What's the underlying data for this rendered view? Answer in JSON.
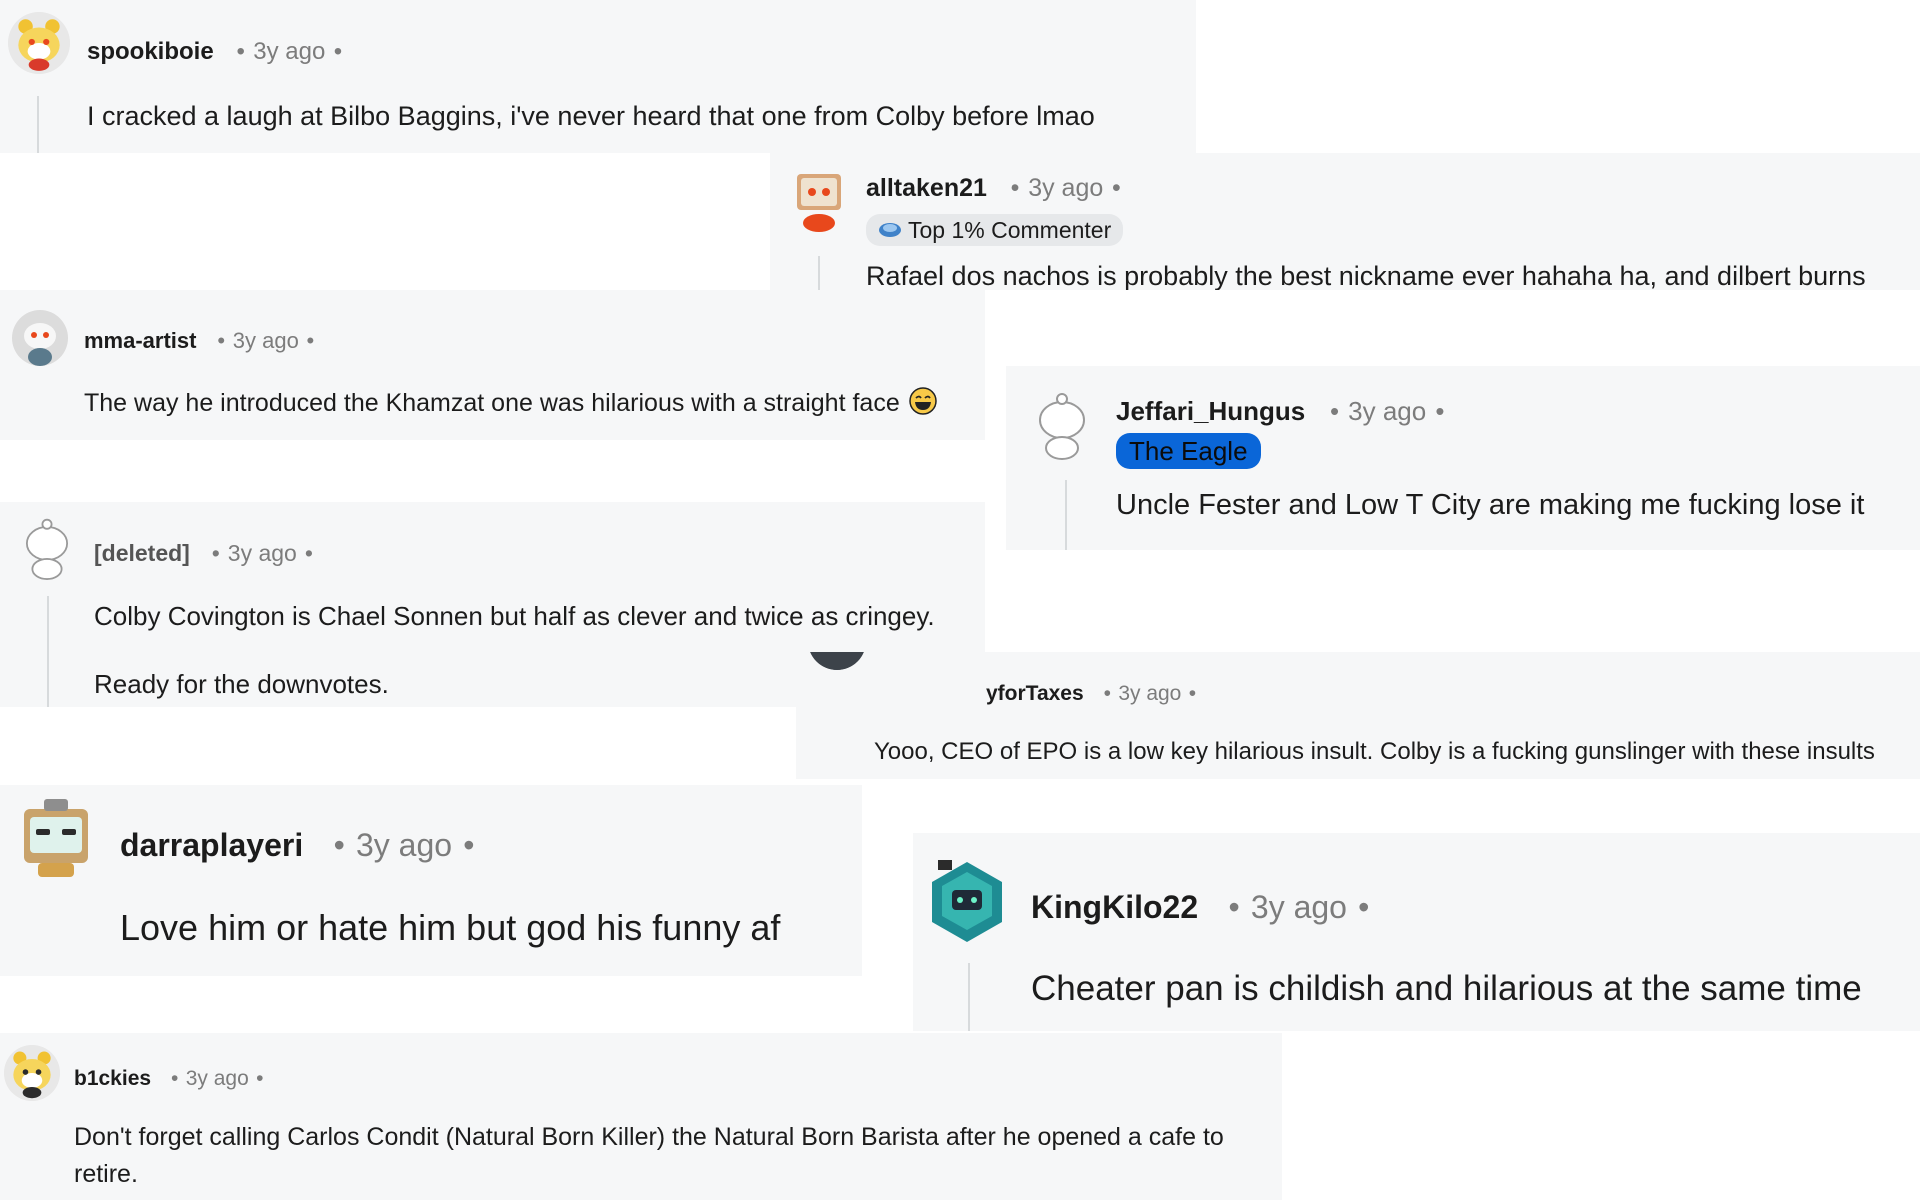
{
  "comments": [
    {
      "username": "spookiboie",
      "time": "3y ago",
      "text": "I cracked a laugh at Bilbo Baggins, i've never heard that one from Colby before lmao",
      "avatar": "bear-snoo-avatar"
    },
    {
      "username": "alltaken21",
      "time": "3y ago",
      "flair": "Top 1% Commenter",
      "flair_icon": "commenter-badge-icon",
      "text": "Rafael dos nachos is probably the best nickname ever hahaha ha, and dilbert burns",
      "avatar": "box-head-snoo-avatar"
    },
    {
      "username": "mma-artist",
      "time": "3y ago",
      "text": "The way he introduced the Khamzat one was hilarious with a straight face",
      "emoji": "laughing-emoji",
      "avatar": "grey-snoo-avatar"
    },
    {
      "username": "Jeffari_Hungus",
      "time": "3y ago",
      "flair": "The Eagle",
      "text": "Uncle Fester and Low T City are making me fucking lose it",
      "avatar": "default-snoo-avatar"
    },
    {
      "username": "[deleted]",
      "time": "3y ago",
      "text": "Colby Covington is Chael Sonnen but half as clever and twice as cringey.",
      "text2": "Ready for the downvotes.",
      "avatar": "default-snoo-avatar"
    },
    {
      "username": "yforTaxes",
      "time": "3y ago",
      "text": "Yooo, CEO of EPO is a low key hilarious insult. Colby is a fucking gunslinger with these insults",
      "avatar": "dark-avatar"
    },
    {
      "username": "darraplayeri",
      "time": "3y ago",
      "text": "Love him or hate him but god his funny af",
      "avatar": "tv-head-snoo-avatar"
    },
    {
      "username": "KingKilo22",
      "time": "3y ago",
      "text": "Cheater pan is childish and hilarious at the same time",
      "avatar": "hex-teal-avatar"
    },
    {
      "username": "b1ckies",
      "time": "3y ago",
      "text": "Don't forget calling Carlos Condit (Natural Born Killer) the Natural Born Barista after he opened a cafe to retire.",
      "avatar": "bear-snoo-avatar"
    }
  ],
  "separator": "•",
  "colors": {
    "card_bg": "#f6f7f8",
    "flair_blue": "#0a66d8",
    "flair_grey": "#e6e8ea",
    "meta_text": "#7c7c7c"
  }
}
